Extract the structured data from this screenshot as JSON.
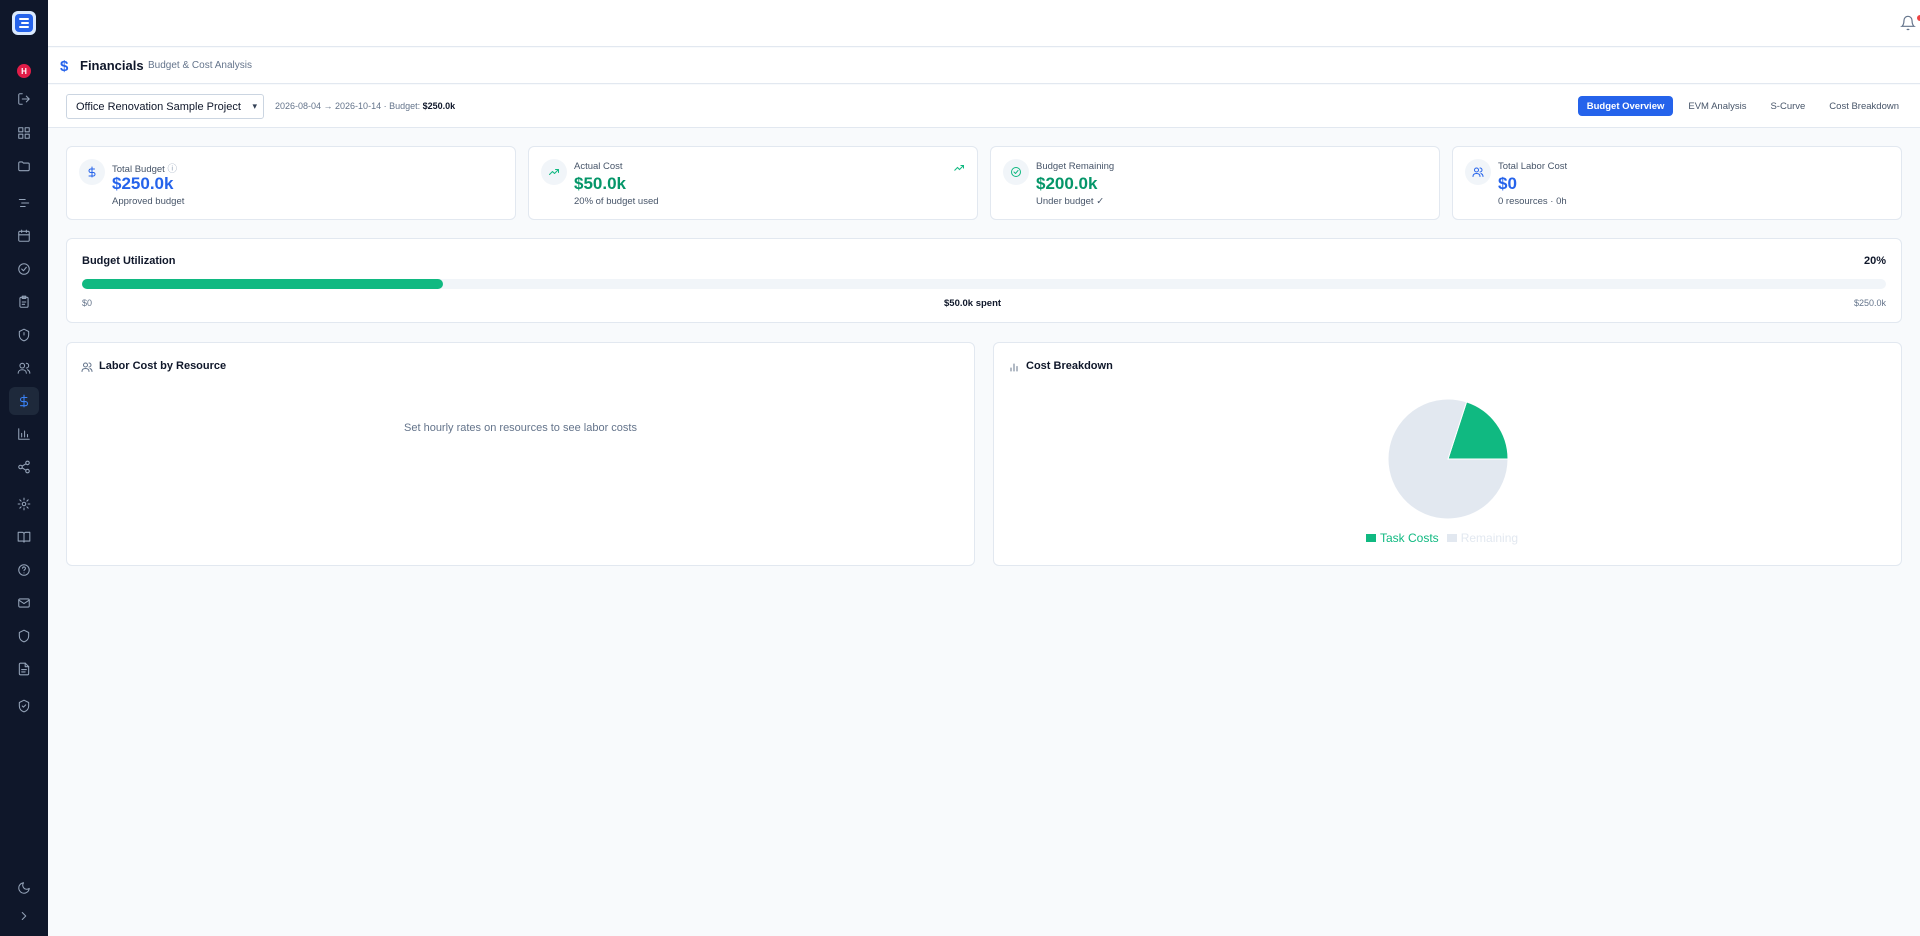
{
  "app": {
    "user_initial": "H"
  },
  "page": {
    "title": "Financials",
    "subtitle": "Budget & Cost Analysis"
  },
  "toolbar": {
    "project": "Office Renovation Sample Project",
    "date_range": "2026-08-04 → 2026-10-14 · Budget: ",
    "budget": "$250.0k",
    "tabs": [
      "Budget Overview",
      "EVM Analysis",
      "S-Curve",
      "Cost Breakdown"
    ],
    "active_tab": "Budget Overview"
  },
  "cards": [
    {
      "label": "Total Budget",
      "value": "$250.0k",
      "sub": "Approved budget",
      "color": "#2563eb"
    },
    {
      "label": "Actual Cost",
      "value": "$50.0k",
      "sub": "20% of budget used",
      "color": "#059669"
    },
    {
      "label": "Budget Remaining",
      "value": "$200.0k",
      "sub": "Under budget ✓",
      "color": "#059669"
    },
    {
      "label": "Total Labor Cost",
      "value": "$0",
      "sub": "0 resources · 0h",
      "color": "#2563eb"
    }
  ],
  "utilization": {
    "title": "Budget Utilization",
    "percent_label": "20%",
    "fraction": 0.2,
    "min_label": "$0",
    "spent_label": "$50.0k spent",
    "max_label": "$250.0k"
  },
  "labor_panel": {
    "title": "Labor Cost by Resource",
    "empty_message": "Set hourly rates on resources to see labor costs"
  },
  "cost_panel": {
    "title": "Cost Breakdown",
    "legend": [
      {
        "label": "Task Costs",
        "color": "#10b981"
      },
      {
        "label": "Remaining",
        "color": "#e2e8f0"
      }
    ]
  },
  "chart_data": {
    "type": "pie",
    "categories": [
      "Task Costs",
      "Remaining"
    ],
    "values": [
      50,
      200
    ],
    "colors": [
      "#10b981",
      "#e2e8f0"
    ]
  }
}
